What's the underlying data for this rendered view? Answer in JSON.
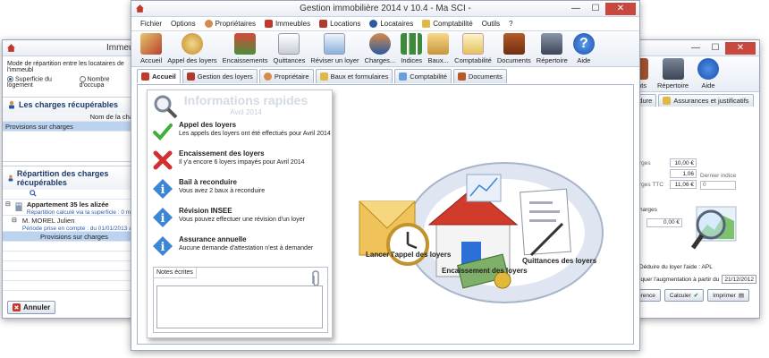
{
  "left_window": {
    "title": "Immeub",
    "description": "Mode de répartition entre les locataires de l'immeubl",
    "radio_surface": "Superficie du logement",
    "radio_count": "Nombre d'occupa",
    "charges_header": "Les charges récupérables",
    "column_name": "Nom de la cha",
    "charge_row": "Provisions sur charges",
    "repart_header": "Répartition des charges récupérables",
    "building": "Appartement 35 les alizée",
    "building_note": "Répartition calculé via la superficie : 0 m²",
    "tenant": "M. MOREL Julien",
    "tenant_note": "Période prise en compte : du 01/01/2013 au",
    "tenant_charge": "Provisions sur charges",
    "cancel_button": "Annuler"
  },
  "right_window": {
    "toolbar_items": [
      "ents",
      "Répertoire",
      "Aide"
    ],
    "tabs": [
      "ondure",
      "Assurances et justificatifs"
    ],
    "field_labels": [
      "rges",
      "rges TTC",
      "Dernier indice"
    ],
    "field_values": [
      "10,00 €",
      "1,06",
      "11,06 €",
      "0"
    ],
    "charges_label": "harges",
    "charges_value": "0,00 €",
    "deduire": "Déduire du loyer l'aide : APL",
    "augmentation": "iquer l'augmentation à partir du",
    "date_value": "21/12/2012",
    "btn_ref": "érence",
    "btn_calc": "Calculer",
    "btn_print": "Imprimer"
  },
  "main_window": {
    "title": "Gestion immobilière 2014  v 10.4 - Ma SCI -",
    "menu": [
      "Fichier",
      "Options",
      "Propriétaires",
      "Immeubles",
      "Locations",
      "Locataires",
      "Comptabilité",
      "Outils",
      "?"
    ],
    "toolbar": [
      "Accueil",
      "Appel des loyers",
      "Encaissements",
      "Quittances",
      "Réviser un loyer",
      "Charges...",
      "Indices",
      "Baux...",
      "Comptabilité",
      "Documents",
      "Répertoire",
      "Aide"
    ],
    "tabs": [
      "Accueil",
      "Gestion des loyers",
      "Propriétaire",
      "Baux et formulaires",
      "Comptabilité",
      "Documents"
    ],
    "quick": {
      "title": "Informations rapides",
      "subtitle": "Avril 2014",
      "items": [
        {
          "heading": "Appel des loyers",
          "detail": "Les appels des loyers ont été effectués pour Avril 2014",
          "icon": "check-icon"
        },
        {
          "heading": "Encaissement des loyers",
          "detail": "Il y'a encore 6 loyers impayés pour Avril 2014",
          "icon": "cross-icon"
        },
        {
          "heading": "Bail à reconduire",
          "detail": "Vous avez 2 baux à reconduire",
          "icon": "info-icon"
        },
        {
          "heading": "Révision INSEE",
          "detail": "Vous pouvez effectuer une révision d'un loyer",
          "icon": "info-icon"
        },
        {
          "heading": "Assurance annuelle",
          "detail": "Aucune demande d'attestation n'est à demander",
          "icon": "info-icon"
        }
      ],
      "notes_label": "Notes écrites"
    },
    "illustration": {
      "cap_appel": "Lancer l'appel des loyers",
      "cap_encaissement": "Encaissement des loyers",
      "cap_quittances": "Quittances des loyers"
    }
  },
  "colors": {
    "accent": "#1b3a6b",
    "selection": "#bcd3f0",
    "close": "#c9483d"
  }
}
